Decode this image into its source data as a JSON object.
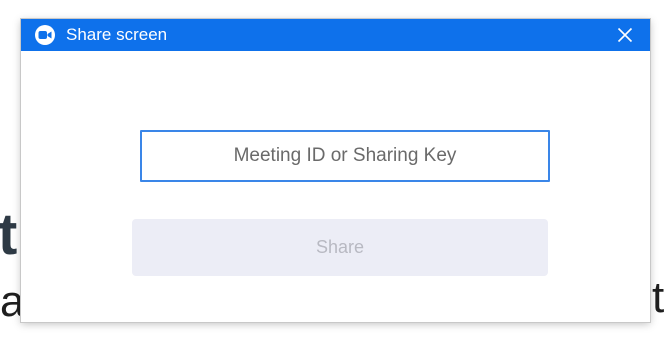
{
  "dialog": {
    "title": "Share screen",
    "app_icon": "zoom-camera-logo-icon",
    "close_icon": "close-icon",
    "input": {
      "placeholder": "Meeting ID or Sharing Key",
      "value": ""
    },
    "share_button": {
      "label": "Share",
      "enabled": false
    }
  },
  "background_page": {
    "heading_fragment": "t",
    "text_left_fragment": "a",
    "text_right_fragment": "t"
  },
  "colors": {
    "titlebar": "#0e71eb",
    "input_border": "#3a86e8",
    "share_button_bg": "#ecedf6",
    "share_button_text": "#b8b9c2"
  }
}
